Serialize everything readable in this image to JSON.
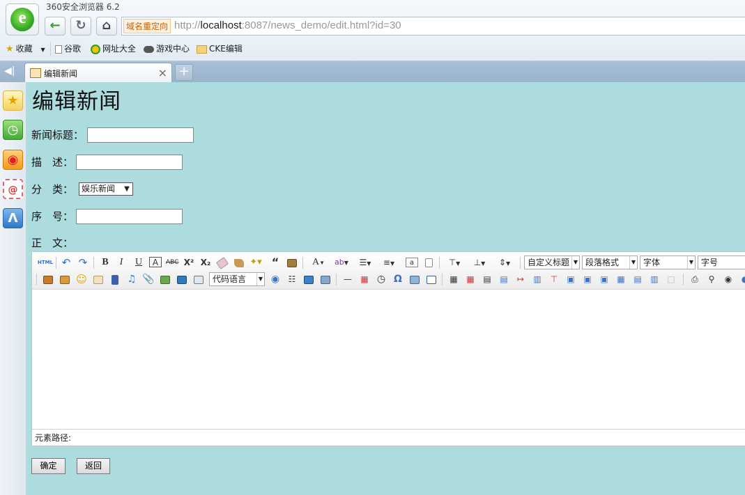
{
  "browser": {
    "app_title": "360安全浏览器 6.2",
    "redirect_tag": "域名重定向",
    "url_prefix": "http://",
    "url_host": "localhost",
    "url_rest": ":8087/news_demo/edit.html?id=30",
    "nav": {
      "back": "back",
      "refresh": "refresh",
      "home": "home"
    },
    "bookmarks": [
      {
        "label": "收藏",
        "icon": "star-plus-icon"
      },
      {
        "label": "谷歌",
        "icon": "page-icon"
      },
      {
        "label": "网址大全",
        "icon": "navigation-icon"
      },
      {
        "label": "游戏中心",
        "icon": "gamepad-icon"
      },
      {
        "label": "CKE编辑",
        "icon": "folder-icon"
      }
    ],
    "tab": {
      "title": "编辑新闻",
      "close": "×",
      "new_tab": "+"
    },
    "sidebar_icons": [
      "star-icon",
      "clock-icon",
      "weibo-icon",
      "mail-icon",
      "app-icon"
    ]
  },
  "page": {
    "title": "编辑新闻",
    "fields": {
      "title_label": "新闻标题：",
      "desc_label": "描　述：",
      "category_label": "分　类：",
      "category_value": "娱乐新闻",
      "order_label": "序　号：",
      "content_label": "正　文："
    },
    "editor": {
      "combo_code": "代码语言",
      "combo_heading": "自定义标题",
      "combo_paragraph": "段落格式",
      "combo_font": "字体",
      "combo_size": "字号",
      "element_path": "元素路径:"
    },
    "buttons": {
      "ok": "确定",
      "back": "返回"
    }
  }
}
